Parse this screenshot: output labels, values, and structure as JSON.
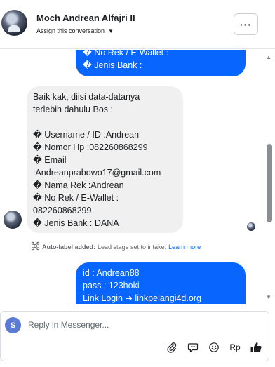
{
  "header": {
    "contact_name": "Moch Andrean Alfajri II",
    "assign_label": "Assign this conversation",
    "more_label": "···"
  },
  "messages": {
    "outgoing_top": [
      "� No Rek / E-Wallet :",
      "� Jenis Bank :"
    ],
    "incoming": [
      "Baik kak, diisi data-datanya",
      "terlebih dahulu Bos :",
      "",
      "� Username / ID :Andrean",
      "� Nomor Hp :082260868299",
      "� Email",
      ":Andreanprabowo17@gmail.com",
      "� Nama Rek :Andrean",
      "� No Rek / E-Wallet :",
      "082260868299",
      "� Jenis Bank : DANA"
    ],
    "outgoing_bottom": [
      "id : Andrean88",
      "pass : 123hoki",
      "Link Login ➜ linkpelangi4d.org"
    ]
  },
  "auto_label": {
    "prefix": "Auto-label added:",
    "text": "Lead stage set to intake.",
    "link": "Learn more"
  },
  "composer": {
    "avatar_letter": "S",
    "placeholder": "Reply in Messenger...",
    "language_label": "Rp"
  },
  "colors": {
    "accent": "#0866ff",
    "incoming_bubble": "#f0f0f0"
  }
}
